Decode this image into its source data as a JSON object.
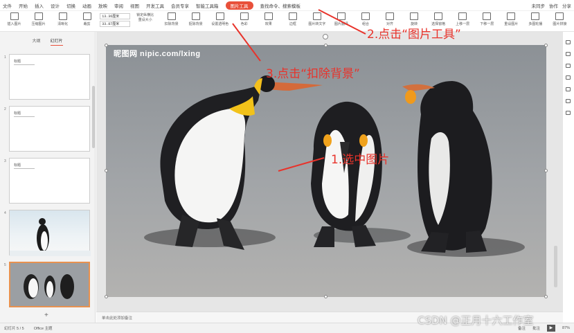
{
  "menubar": {
    "items": [
      "文件",
      "开始",
      "插入",
      "设计",
      "切换",
      "动画",
      "放映",
      "审阅",
      "视图",
      "开发工具",
      "会员专享",
      "智能工具箱"
    ],
    "active_tool_tab": "图片工具",
    "search_label": "查找命令、搜索模板",
    "right_items": [
      "未同步",
      "协作",
      "分享"
    ]
  },
  "ribbon": {
    "groups": [
      "插入图片",
      "压缩图片",
      "清晰化",
      "裁剪",
      "重设大小",
      "扣除背景",
      "抠除背景",
      "设置透明色",
      "色彩",
      "效果",
      "边框",
      "图片转文字",
      "图片翻译",
      "组合",
      "对齐",
      "旋转",
      "选择窗格",
      "上移一层",
      "下移一层",
      "重设图片",
      "多图轮播",
      "图片拼接"
    ],
    "height_value": "13.36厘米",
    "width_value": "33.87厘米",
    "lock_ratio": "锁定纵横比"
  },
  "sidebar": {
    "tabs": [
      "大纲",
      "幻灯片"
    ],
    "slides": [
      {
        "num": "1",
        "title": "标题"
      },
      {
        "num": "2",
        "title": "标题"
      },
      {
        "num": "3",
        "title": "标题"
      },
      {
        "num": "4",
        "title": ""
      },
      {
        "num": "5",
        "title": ""
      }
    ],
    "add_slide": "+"
  },
  "canvas": {
    "watermark": "昵图网 nipic.com/lxing"
  },
  "notes": {
    "placeholder": "单击此处添加备注"
  },
  "statusbar": {
    "slide_info": "幻灯片 5 / 5",
    "theme": "Office 主题",
    "notes_label": "备注",
    "comment_label": "批注",
    "zoom": "87%"
  },
  "annotations": {
    "step1": "1.选中图片",
    "step2": "2.点击“图片工具”",
    "step3": "3.点击“扣除背景”",
    "credit": "CSDN @正月十六工作室"
  },
  "colors": {
    "accent": "#e8503a",
    "annotation": "#e8332b"
  }
}
